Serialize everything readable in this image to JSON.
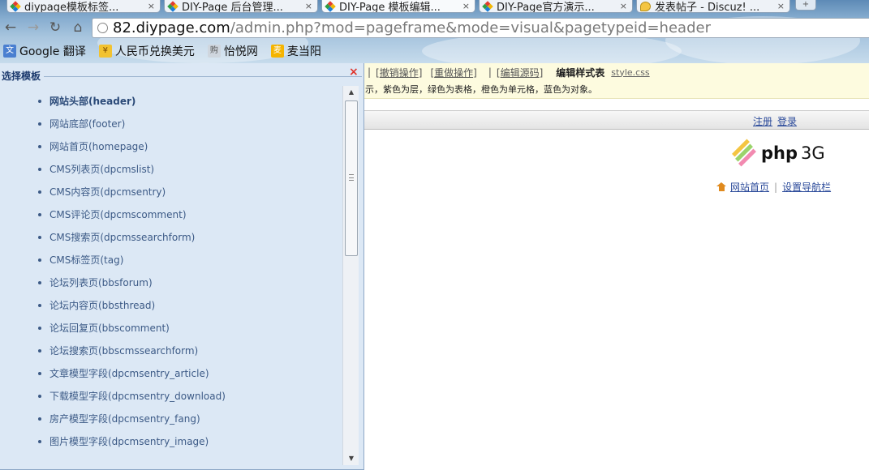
{
  "browser": {
    "tabs": [
      {
        "title": "diypage模板标签...",
        "close": "×"
      },
      {
        "title": "DIY-Page 后台管理...",
        "close": "×"
      },
      {
        "title": "DIY-Page 模板编辑...",
        "close": "×"
      },
      {
        "title": "DIY-Page官方演示...",
        "close": "×"
      },
      {
        "title": "发表帖子 - Discuz! ...",
        "close": "×"
      }
    ],
    "new_tab": "+",
    "nav": {
      "back": "←",
      "forward": "→",
      "reload": "↻",
      "home": "⌂"
    },
    "address": {
      "host": "82.diypage.com",
      "path": "/admin.php?mod=pageframe&mode=visual&pagetypeid=header"
    },
    "bookmarks": [
      {
        "label": "Google 翻译",
        "icon": "translate-icon"
      },
      {
        "label": "人民币兑换美元",
        "icon": "currency-icon"
      },
      {
        "label": "怡悦网",
        "icon": "shop-icon"
      },
      {
        "label": "麦当阳",
        "icon": "mcd-icon"
      }
    ]
  },
  "panel": {
    "title": "选择模板",
    "close": "×",
    "templates": [
      "网站头部(header)",
      "网站底部(footer)",
      "网站首页(homepage)",
      "CMS列表页(dpcmslist)",
      "CMS内容页(dpcmsentry)",
      "CMS评论页(dpcmscomment)",
      "CMS搜索页(dpcmssearchform)",
      "CMS标签页(tag)",
      "论坛列表页(bbsforum)",
      "论坛内容页(bbsthread)",
      "论坛回复页(bbscomment)",
      "论坛搜索页(bbscmssearchform)",
      "文章模型字段(dpcmsentry_article)",
      "下载模型字段(dpcmsentry_download)",
      "房产模型字段(dpcmsentry_fang)",
      "图片模型字段(dpcmsentry_image)"
    ],
    "active_index": 0,
    "scroll": {
      "up": "▲",
      "down": "▼"
    }
  },
  "editor": {
    "toolbar": {
      "sep": "|",
      "undo": "撤销操作",
      "redo": "重做操作",
      "edit_source": "编辑源码",
      "edit_style": "编辑样式表",
      "css_file": "style.css"
    },
    "hint": "示，紫色为层，绿色为表格，橙色为单元格，蓝色为对象。"
  },
  "site": {
    "register": "注册",
    "login": "登录",
    "logo_text": "php",
    "logo_ver": "3G",
    "nav_home": "网站首页",
    "nav_divider": "|",
    "nav_settings": "设置导航栏"
  }
}
